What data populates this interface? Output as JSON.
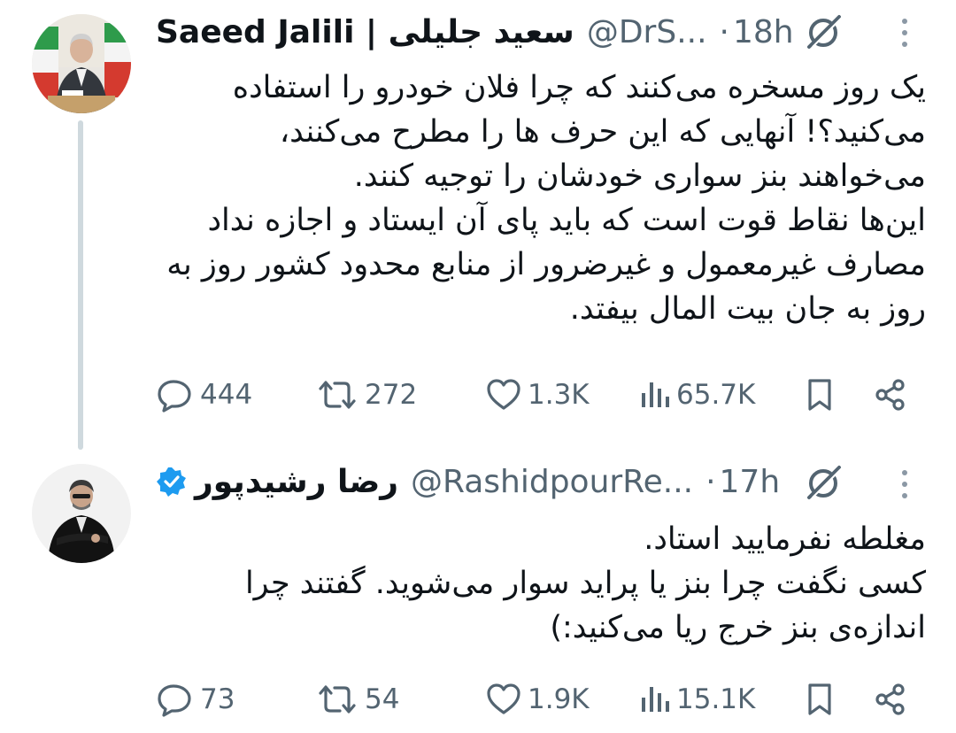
{
  "tweet1": {
    "display_name": "Saeed Jalili | سعید جلیلی",
    "handle": "@DrS...",
    "dot": "·",
    "time": "18h",
    "lines": [
      "یک روز مسخره می‌کنند که چرا فلان خودرو را استفاده",
      "می‌کنید؟! آنهایی که این حرف ها را مطرح می‌کنند،",
      "می‌خواهند بنز سواری خودشان را توجیه کنند.",
      "این‌ها نقاط قوت است که باید پای آن ایستاد و اجازه نداد",
      "مصارف غیرمعمول و غیرضرور از منابع محدود کشور روز به",
      "روز به جان بیت المال بیفتد."
    ],
    "replies": "444",
    "reposts": "272",
    "likes": "1.3K",
    "views": "65.7K"
  },
  "tweet2": {
    "display_name": "رضا رشیدپور",
    "handle": "@RashidpourRe...",
    "dot": "·",
    "time": "17h",
    "lines": [
      "مغلطه نفرمایید استاد.",
      "کسی نگفت چرا بنز یا پراید سوار می‌شوید. گفتند چرا",
      "اندازه‌ی بنز خرج ریا می‌کنید:)"
    ],
    "replies": "73",
    "reposts": "54",
    "likes": "1.9K",
    "views": "15.1K"
  },
  "colors": {
    "text": "#0f1419",
    "secondary": "#536471",
    "verified": "#1d9bf0",
    "thread_line": "#cfd9de"
  },
  "icons": [
    "reply-icon",
    "repost-icon",
    "like-icon",
    "views-icon",
    "bookmark-icon",
    "share-icon",
    "grok-icon",
    "more-icon",
    "verified-badge-icon"
  ]
}
